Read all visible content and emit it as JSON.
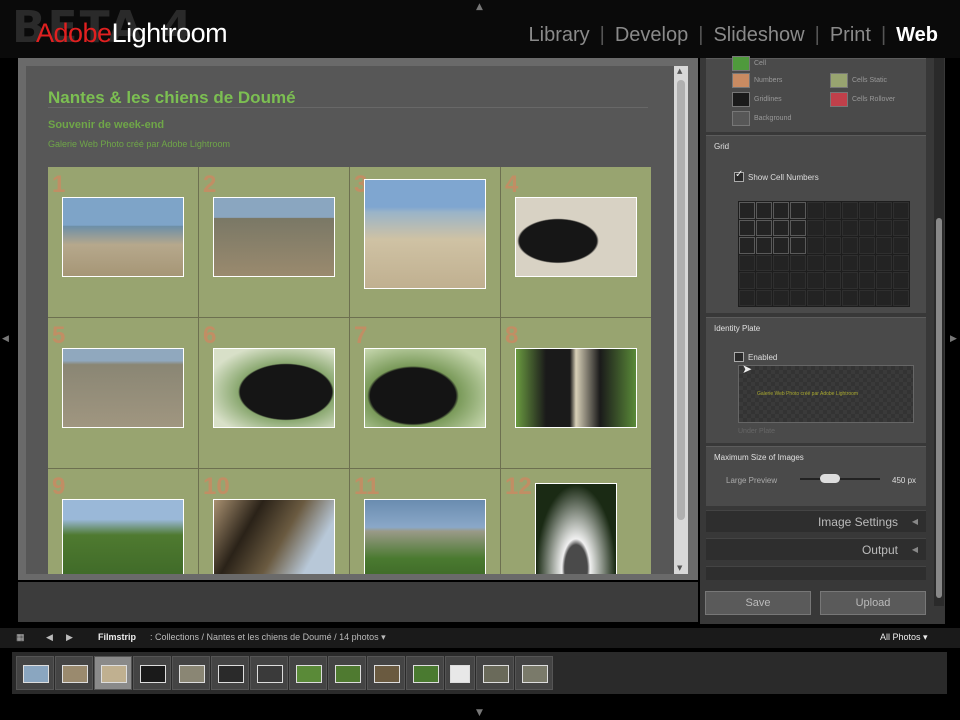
{
  "app": {
    "beta_watermark": "BETA 4",
    "brand": "Adobe",
    "name": "Lightroom",
    "modules": [
      "Library",
      "Develop",
      "Slideshow",
      "Print",
      "Web"
    ],
    "active_module": "Web"
  },
  "gallery": {
    "site_title": "Nantes & les chiens de Doumé",
    "collection_title": "Souvenir de week-end",
    "collection_desc": "Galerie Web Photo créé par Adobe Lightroom",
    "cells": [
      {
        "num": "1",
        "thumb": "dogs-beach"
      },
      {
        "num": "2",
        "thumb": "dog-beach-people"
      },
      {
        "num": "3",
        "thumb": "dogs-running-sand"
      },
      {
        "num": "4",
        "thumb": "black-dog-portrait"
      },
      {
        "num": "5",
        "thumb": "two-dogs-shore"
      },
      {
        "num": "6",
        "thumb": "black-dog-closeup"
      },
      {
        "num": "7",
        "thumb": "black-dog-trees"
      },
      {
        "num": "8",
        "thumb": "three-dogs-grass"
      },
      {
        "num": "9",
        "thumb": "tree-landscape"
      },
      {
        "num": "10",
        "thumb": "dog-in-tree"
      },
      {
        "num": "11",
        "thumb": "chateau"
      },
      {
        "num": "12",
        "thumb": "monument-trees"
      }
    ]
  },
  "panel": {
    "colors": {
      "rows": [
        {
          "left": {
            "label": "Cell",
            "color": "#4f9a3c"
          }
        },
        {
          "left": {
            "label": "Numbers",
            "color": "#c98b62"
          },
          "right": {
            "label": "Cells Static",
            "color": "#98a470"
          }
        },
        {
          "left": {
            "label": "Gridlines",
            "color": "#1a1a1a"
          },
          "right": {
            "label": "Cells Rollover",
            "color": "#c0404a"
          }
        },
        {
          "left": {
            "label": "Background",
            "color": "#575757"
          }
        }
      ]
    },
    "grid": {
      "title": "Grid",
      "show_cell_numbers": "Show Cell Numbers",
      "show_cell_numbers_checked": true
    },
    "identity_plate": {
      "title": "Identity Plate",
      "enabled_label": "Enabled",
      "plate_text": "Galerie Web Photo créé par Adobe Lightroom",
      "under_text": "Under Plate"
    },
    "max_size": {
      "title": "Maximum Size of Images",
      "label": "Large Preview",
      "value": "450",
      "unit": "px",
      "slider_fraction": 0.45
    },
    "sections": [
      "Image Settings",
      "Output"
    ],
    "save_label": "Save",
    "upload_label": "Upload"
  },
  "filmstrip": {
    "title": "Filmstrip",
    "path": "Collections / Nantes et les chiens de Doumé / 14 photos",
    "filter": "All Photos",
    "thumb_count": 14,
    "selected_index": 2
  }
}
